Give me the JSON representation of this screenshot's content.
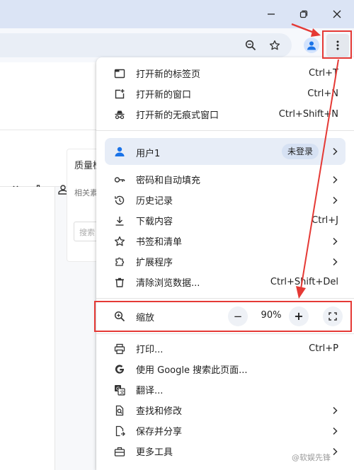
{
  "window": {
    "controls": [
      "minimize-icon",
      "restore-icon",
      "close-icon"
    ]
  },
  "toolbar": {
    "icons": [
      "zoom-icon",
      "bookmark-star-icon",
      "profile-icon",
      "more-vertical-icon"
    ]
  },
  "background_page": {
    "card_title": "质量检",
    "card_subtitle": "相关素",
    "card_input_placeholder": "搜索",
    "toolbar_icons": [
      "code-icon",
      "bar-chart-icon",
      "user-icon",
      "link-icon"
    ]
  },
  "menu": {
    "group1": [
      {
        "icon": "new-tab-icon",
        "label": "打开新的标签页",
        "shortcut": "Ctrl+T"
      },
      {
        "icon": "new-window-icon",
        "label": "打开新的窗口",
        "shortcut": "Ctrl+N"
      },
      {
        "icon": "incognito-icon",
        "label": "打开新的无痕式窗口",
        "shortcut": "Ctrl+Shift+N"
      }
    ],
    "profile": {
      "name": "用户1",
      "status": "未登录"
    },
    "group2": [
      {
        "icon": "key-icon",
        "label": "密码和自动填充",
        "shortcut": ""
      },
      {
        "icon": "history-icon",
        "label": "历史记录",
        "shortcut": ""
      },
      {
        "icon": "download-icon",
        "label": "下载内容",
        "shortcut": "Ctrl+J"
      },
      {
        "icon": "star-icon",
        "label": "书签和清单",
        "shortcut": ""
      },
      {
        "icon": "extension-icon",
        "label": "扩展程序",
        "shortcut": ""
      },
      {
        "icon": "trash-icon",
        "label": "清除浏览数据...",
        "shortcut": "Ctrl+Shift+Del"
      }
    ],
    "zoom": {
      "label": "缩放",
      "minus": "−",
      "value": "90%",
      "plus": "+"
    },
    "group3": [
      {
        "icon": "print-icon",
        "label": "打印...",
        "shortcut": "Ctrl+P"
      },
      {
        "icon": "google-icon",
        "label": "使用 Google 搜索此页面...",
        "shortcut": ""
      },
      {
        "icon": "translate-icon",
        "label": "翻译...",
        "shortcut": ""
      },
      {
        "icon": "find-icon",
        "label": "查找和修改",
        "shortcut": ""
      },
      {
        "icon": "save-share-icon",
        "label": "保存并分享",
        "shortcut": ""
      },
      {
        "icon": "toolbox-icon",
        "label": "更多工具",
        "shortcut": ""
      }
    ]
  },
  "annotations": {
    "color": "#e53935"
  },
  "watermark": "@软娱先锋"
}
